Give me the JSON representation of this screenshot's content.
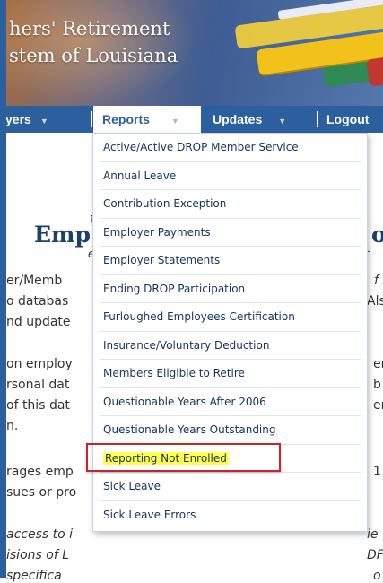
{
  "header": {
    "title_line1": "hers' Retirement",
    "title_line2": "stem of Louisiana"
  },
  "nav": {
    "items": [
      {
        "label": "yers"
      },
      {
        "label": "Reports"
      },
      {
        "label": "Updates"
      },
      {
        "label": "Logout"
      }
    ]
  },
  "dropdown": {
    "items": [
      {
        "label": "Active/Active DROP Member Service"
      },
      {
        "label": "Annual Leave"
      },
      {
        "label": "Contribution Exception"
      },
      {
        "label": "Employer Payments"
      },
      {
        "label": "Employer Statements"
      },
      {
        "label": "Ending DROP Participation"
      },
      {
        "label": "Furloughed Employees Certification"
      },
      {
        "label": "Insurance/Voluntary Deduction"
      },
      {
        "label": "Members Eligible to Retire"
      },
      {
        "label": "Questionable Years After 2006"
      },
      {
        "label": "Questionable Years Outstanding"
      },
      {
        "label": "Reporting Not Enrolled"
      },
      {
        "label": "Sick Leave"
      },
      {
        "label": "Sick Leave Errors"
      }
    ],
    "highlighted": "Reporting Not Enrolled"
  },
  "page": {
    "heading_left": "Emp",
    "heading_right": "o",
    "left_lines": [
      "er/Memb",
      "o databas",
      "nd update",
      "on employ",
      "rsonal dat",
      "of this dat",
      "n.",
      "rages emp",
      "sues or pro",
      "access to i",
      "isions of L",
      "specifica"
    ],
    "right_lines": [
      "f s",
      "Als",
      "em",
      "b",
      "er",
      "1",
      "ie",
      "DF",
      "o"
    ],
    "fragments": [
      "P",
      "a",
      "e",
      "t",
      "r"
    ]
  },
  "colors": {
    "nav_bg": "#2b5f9e",
    "menu_text": "#14345f",
    "highlight": "#ffff4d",
    "callout": "#c0282d"
  }
}
